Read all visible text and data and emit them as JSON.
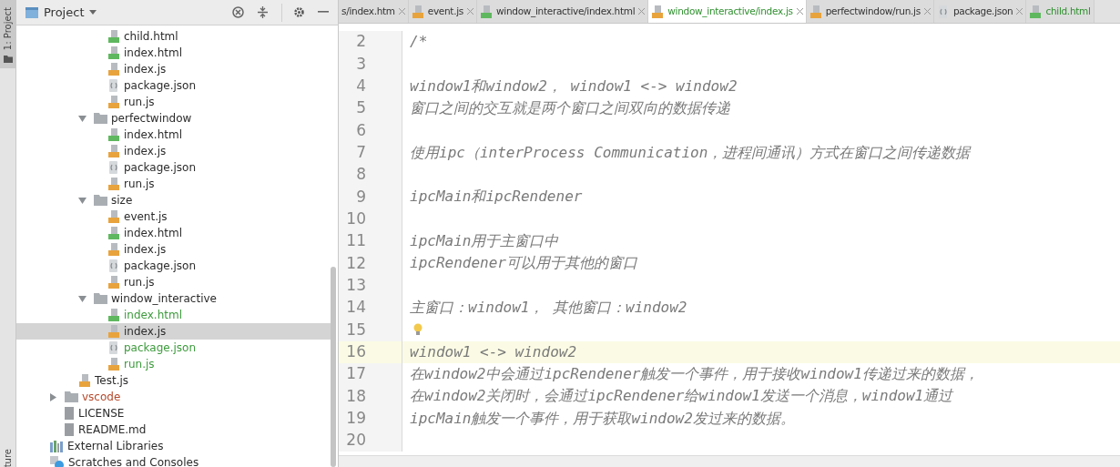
{
  "side_strip": {
    "top_tab": "1: Project",
    "bottom_tab": "ture"
  },
  "project_panel": {
    "title": "Project",
    "tree": [
      {
        "children": [
          {
            "children": [
              {
                "children": [
                  {
                    "name": "child.html",
                    "kind": "html",
                    "color": "#2b2b2b",
                    "selected": false
                  },
                  {
                    "name": "index.html",
                    "kind": "html",
                    "color": "#2b2b2b",
                    "selected": false
                  },
                  {
                    "name": "index.js",
                    "kind": "js",
                    "color": "#2b2b2b",
                    "selected": false
                  },
                  {
                    "name": "package.json",
                    "kind": "json",
                    "color": "#2b2b2b",
                    "selected": false
                  },
                  {
                    "name": "run.js",
                    "kind": "js",
                    "color": "#2b2b2b",
                    "selected": false
                  }
                ]
              },
              {
                "name": "perfectwindow",
                "kind": "folder",
                "expanded": true,
                "color": "#2b2b2b",
                "selected": false,
                "children": [
                  {
                    "name": "index.html",
                    "kind": "html",
                    "color": "#2b2b2b",
                    "selected": false
                  },
                  {
                    "name": "index.js",
                    "kind": "js",
                    "color": "#2b2b2b",
                    "selected": false
                  },
                  {
                    "name": "package.json",
                    "kind": "json",
                    "color": "#2b2b2b",
                    "selected": false
                  },
                  {
                    "name": "run.js",
                    "kind": "js",
                    "color": "#2b2b2b",
                    "selected": false
                  }
                ]
              },
              {
                "name": "size",
                "kind": "folder",
                "expanded": true,
                "color": "#2b2b2b",
                "selected": false,
                "children": [
                  {
                    "name": "event.js",
                    "kind": "js",
                    "color": "#2b2b2b",
                    "selected": false
                  },
                  {
                    "name": "index.html",
                    "kind": "html",
                    "color": "#2b2b2b",
                    "selected": false
                  },
                  {
                    "name": "index.js",
                    "kind": "js",
                    "color": "#2b2b2b",
                    "selected": false
                  },
                  {
                    "name": "package.json",
                    "kind": "json",
                    "color": "#2b2b2b",
                    "selected": false
                  },
                  {
                    "name": "run.js",
                    "kind": "js",
                    "color": "#2b2b2b",
                    "selected": false
                  }
                ]
              },
              {
                "name": "window_interactive",
                "kind": "folder",
                "expanded": true,
                "color": "#2b2b2b",
                "selected": false,
                "children": [
                  {
                    "name": "index.html",
                    "kind": "html",
                    "color": "#3c9a3c",
                    "selected": false
                  },
                  {
                    "name": "index.js",
                    "kind": "js",
                    "color": "#2b2b2b",
                    "selected": true
                  },
                  {
                    "name": "package.json",
                    "kind": "json",
                    "color": "#3c9a3c",
                    "selected": false
                  },
                  {
                    "name": "run.js",
                    "kind": "js",
                    "color": "#3c9a3c",
                    "selected": false
                  }
                ]
              }
            ]
          },
          {
            "name": "Test.js",
            "kind": "js",
            "color": "#2b2b2b",
            "selected": false
          }
        ]
      },
      {
        "name": "vscode",
        "kind": "folder",
        "expanded": false,
        "color": "#b5482a",
        "selected": false
      },
      {
        "name": "LICENSE",
        "kind": "text",
        "color": "#2b2b2b",
        "selected": false
      },
      {
        "name": "README.md",
        "kind": "text",
        "color": "#2b2b2b",
        "selected": false
      }
    ],
    "extras": [
      {
        "name": "External Libraries",
        "kind": "library"
      },
      {
        "name": "Scratches and Consoles",
        "kind": "scratch"
      }
    ]
  },
  "editor": {
    "tabs": [
      {
        "label": "s/index.htm",
        "color": "#333333",
        "selected": false
      },
      {
        "label": "event.js",
        "kind": "js",
        "color": "#333333",
        "selected": false
      },
      {
        "label": "window_interactive/index.html",
        "kind": "html",
        "color": "#333333",
        "selected": false
      },
      {
        "label": "window_interactive/index.js",
        "kind": "js",
        "color": "#2f8f2f",
        "selected": true
      },
      {
        "label": "perfectwindow/run.js",
        "kind": "js",
        "color": "#333333",
        "selected": false
      },
      {
        "label": "package.json",
        "kind": "json",
        "color": "#333333",
        "selected": false
      },
      {
        "label": "child.html",
        "kind": "html",
        "color": "#2f8f2f",
        "selected": false
      }
    ],
    "lines": [
      {
        "number": "2",
        "text": "/*",
        "current": false,
        "intention": false
      },
      {
        "number": "3",
        "current": false,
        "intention": false
      },
      {
        "number": "4",
        "text": "window1和window2， window1 <-> window2",
        "current": false,
        "intention": false
      },
      {
        "number": "5",
        "text": "窗口之间的交互就是两个窗口之间双向的数据传递",
        "current": false,
        "intention": false
      },
      {
        "number": "6",
        "current": false,
        "intention": false
      },
      {
        "number": "7",
        "text": "使用ipc（interProcess Communication，进程间通讯）方式在窗口之间传递数据",
        "current": false,
        "intention": false
      },
      {
        "number": "8",
        "current": false,
        "intention": false
      },
      {
        "number": "9",
        "text": "ipcMain和ipcRendener",
        "current": false,
        "intention": false
      },
      {
        "number": "10",
        "current": false,
        "intention": false
      },
      {
        "number": "11",
        "text": "ipcMain用于主窗口中",
        "current": false,
        "intention": false
      },
      {
        "number": "12",
        "text": "ipcRendener可以用于其他的窗口",
        "current": false,
        "intention": false
      },
      {
        "number": "13",
        "current": false,
        "intention": false
      },
      {
        "number": "14",
        "text": "主窗口：window1， 其他窗口：window2",
        "current": false,
        "intention": false
      },
      {
        "number": "15",
        "current": false,
        "intention": true
      },
      {
        "number": "16",
        "text": "window1 <-> window2",
        "current": true,
        "intention": false
      },
      {
        "number": "17",
        "text": "在window2中会通过ipcRendener触发一个事件，用于接收window1传递过来的数据，",
        "current": false,
        "intention": false
      },
      {
        "number": "18",
        "text": "在window2关闭时，会通过ipcRendener给window1发送一个消息，window1通过",
        "current": false,
        "intention": false
      },
      {
        "number": "19",
        "text": "ipcMain触发一个事件，用于获取window2发过来的数据。",
        "current": false,
        "intention": false
      },
      {
        "number": "20",
        "current": false,
        "intention": false
      }
    ]
  }
}
